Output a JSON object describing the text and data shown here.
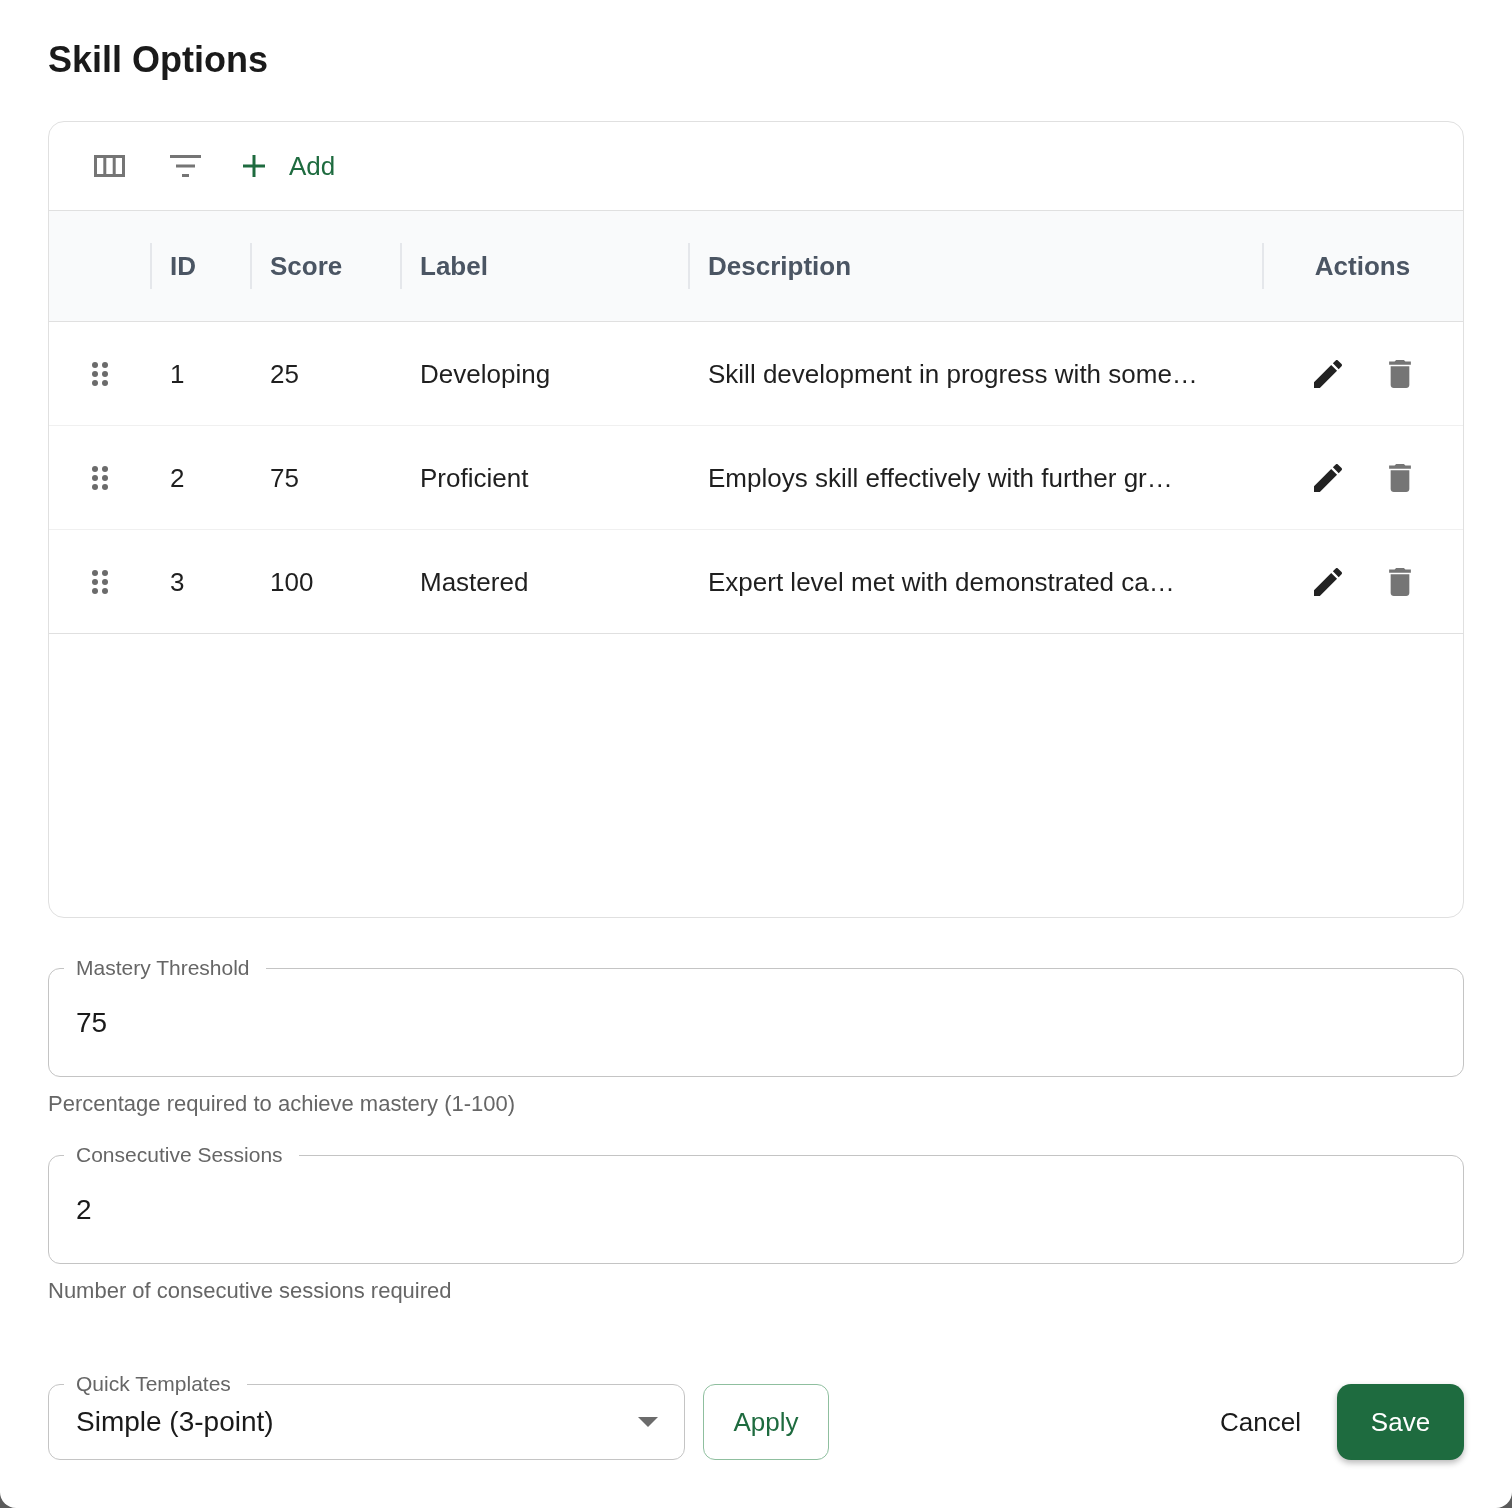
{
  "dialog": {
    "title": "Skill Options"
  },
  "toolbar": {
    "add_button": "Add"
  },
  "table": {
    "columns": [
      "ID",
      "Score",
      "Label",
      "Description",
      "Actions"
    ],
    "rows": [
      {
        "id": "1",
        "score": "25",
        "label": "Developing",
        "description": "Skill development in progress with some…"
      },
      {
        "id": "2",
        "score": "75",
        "label": "Proficient",
        "description": "Employs skill effectively with further gr…"
      },
      {
        "id": "3",
        "score": "100",
        "label": "Mastered",
        "description": "Expert level met with demonstrated ca…"
      }
    ]
  },
  "fields": [
    {
      "label": "Mastery Threshold",
      "value": "75",
      "helper_text": "Percentage required to achieve mastery (1-100)"
    },
    {
      "label": "Consecutive Sessions",
      "value": "2",
      "helper_text": "Number of consecutive sessions required"
    }
  ],
  "template_select": {
    "label": "Quick Templates",
    "value": "Simple (3-point)",
    "apply_button": "Apply"
  },
  "actions": [
    {
      "label": "Cancel",
      "kind": "text"
    },
    {
      "label": "Save",
      "kind": "contained"
    }
  ]
}
